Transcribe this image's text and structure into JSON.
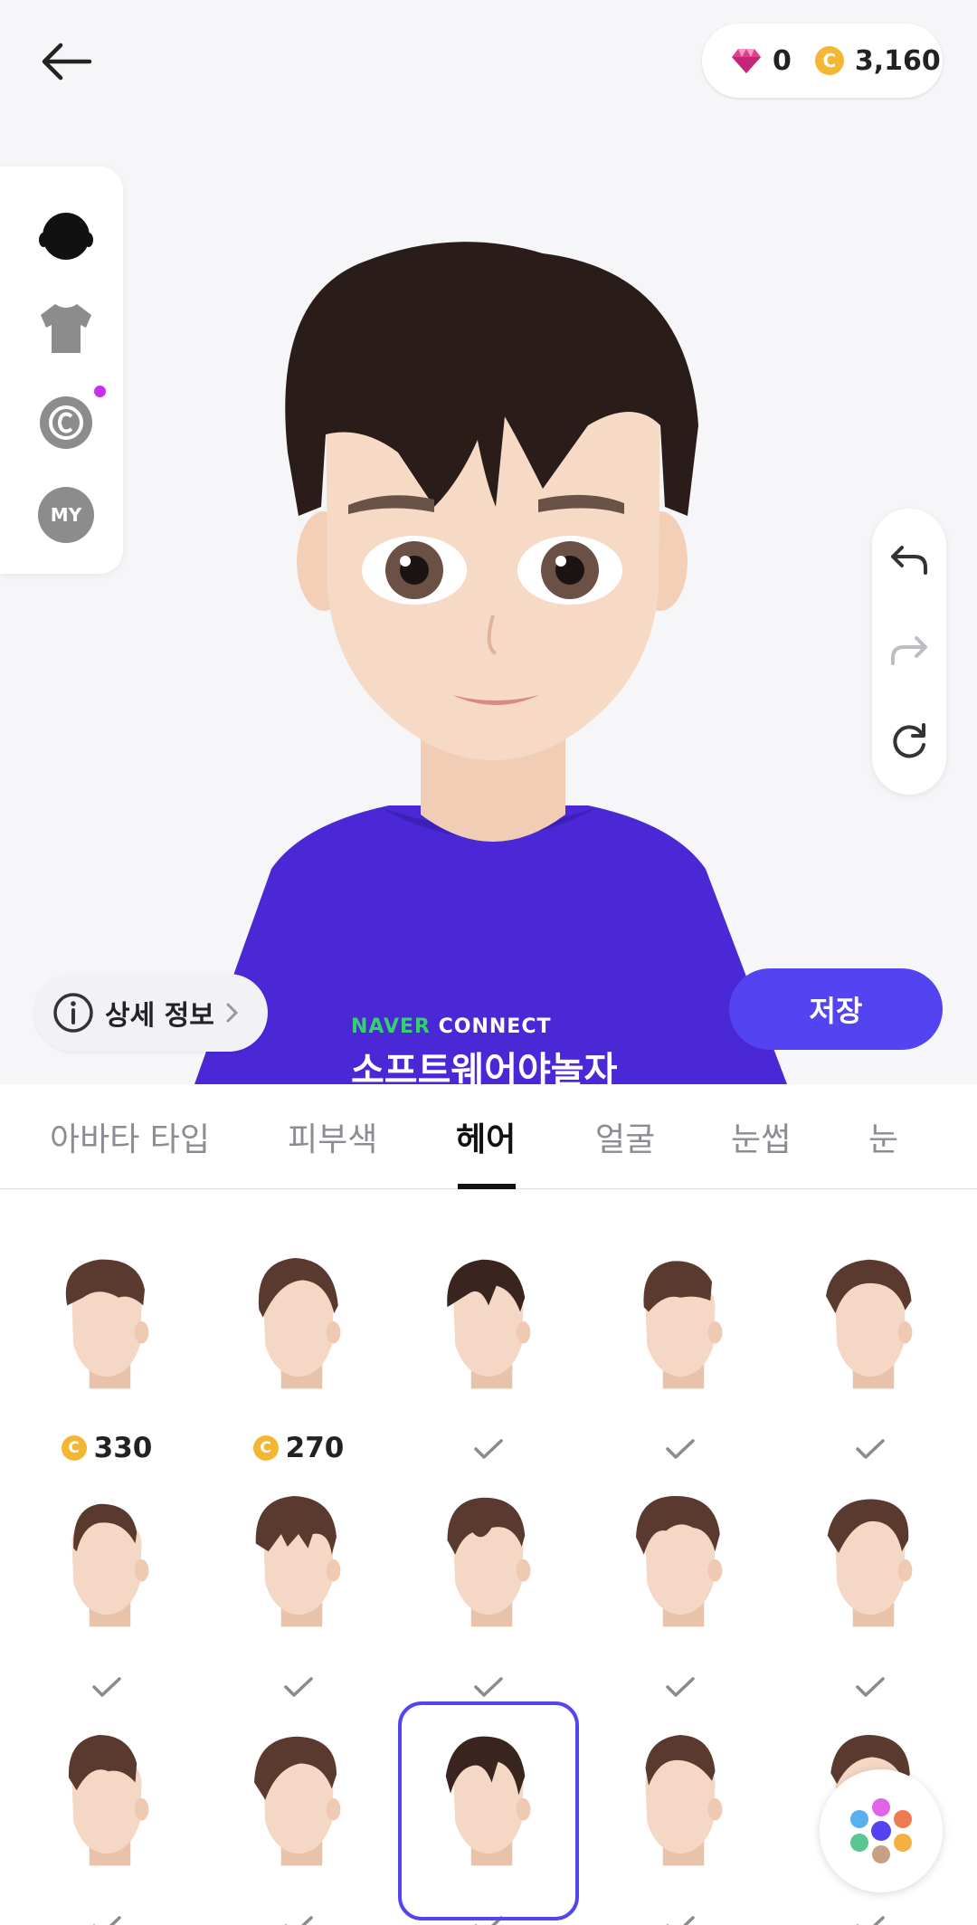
{
  "header": {
    "gem_count": "0",
    "coin_count": "3,160",
    "coin_symbol": "C"
  },
  "side_menu": {
    "items": [
      "avatar-head-icon",
      "tshirt-icon",
      "copyright-coin-icon",
      "my-icon"
    ],
    "my_label": "MY"
  },
  "avatar_shirt_text": {
    "line1_green": "NAVER",
    "line1_white": "CONNECT",
    "line2": "소프트웨어야놀자"
  },
  "info_button": {
    "label": "상세 정보"
  },
  "save_button": {
    "label": "저장"
  },
  "tabs": [
    {
      "label": "아바타 타입"
    },
    {
      "label": "피부색"
    },
    {
      "label": "헤어",
      "active": true
    },
    {
      "label": "얼굴"
    },
    {
      "label": "눈썹"
    },
    {
      "label": "눈"
    }
  ],
  "hair_grid": {
    "rows": [
      [
        {
          "price": "330"
        },
        {
          "price": "270"
        },
        {
          "owned": true
        },
        {
          "owned": true
        },
        {
          "owned": true
        }
      ],
      [
        {
          "owned": true
        },
        {
          "owned": true
        },
        {
          "owned": true
        },
        {
          "owned": true
        },
        {
          "owned": true
        }
      ],
      [
        {
          "owned": true
        },
        {
          "owned": true
        },
        {
          "owned": true,
          "selected": true
        },
        {
          "owned": true
        },
        {
          "owned": true
        }
      ]
    ]
  },
  "colors": {
    "accent": "#5443f0",
    "coin": "#f4b733",
    "gem": "#e0408c",
    "notification_dot": "#c72df2",
    "hair_dark": "#2a1c19",
    "hair_brown": "#5a3a2e",
    "shirt": "#4a28d6"
  }
}
